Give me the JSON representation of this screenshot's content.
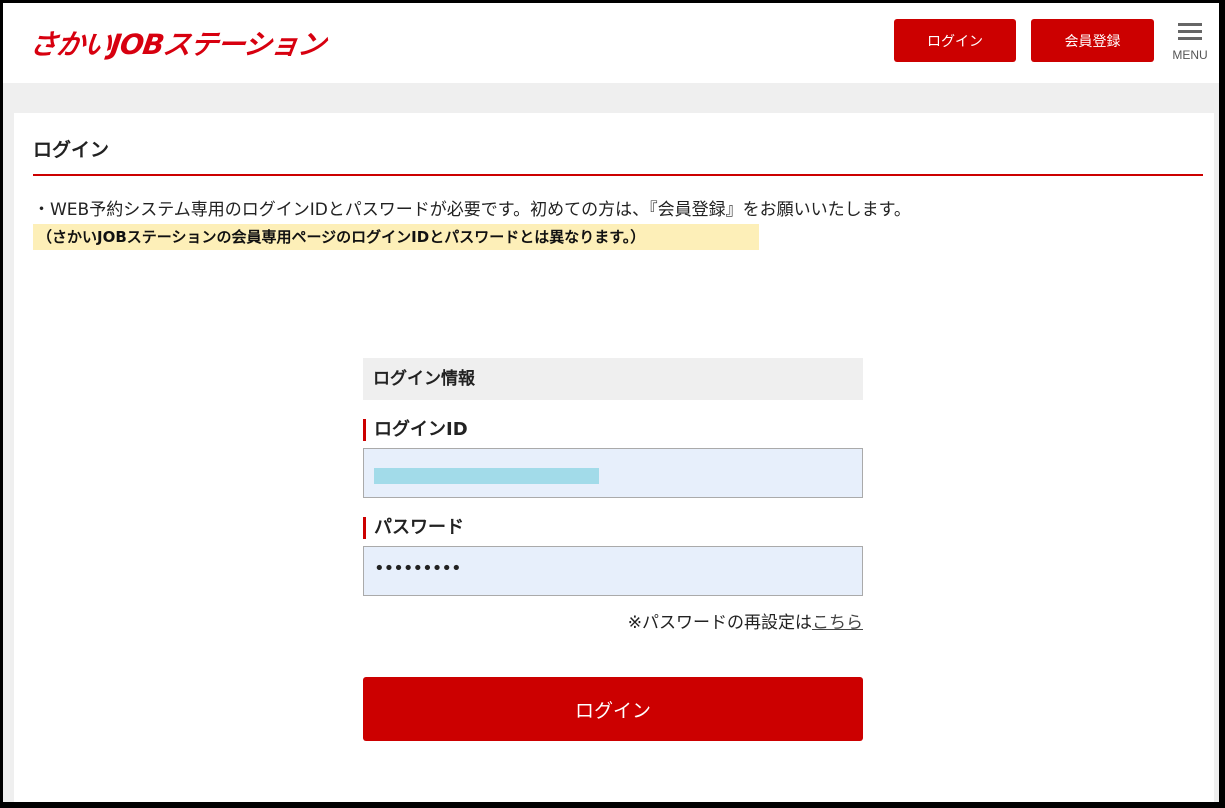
{
  "header": {
    "logo_text": "さかいJOBステーション",
    "login_button": "ログイン",
    "register_button": "会員登録",
    "menu_label": "MENU",
    "brand_color": "#cc0000"
  },
  "page": {
    "title": "ログイン",
    "notice": "・WEB予約システム専用のログインIDとパスワードが必要です。初めての方は、『会員登録』をお願いいたします。",
    "notice_highlight": "（さかいJOBステーションの会員専用ページのログインIDとパスワードとは異なります。）"
  },
  "form": {
    "section_title": "ログイン情報",
    "login_id_label": "ログインID",
    "login_id_value": "",
    "password_label": "パスワード",
    "password_value": "•••••••••",
    "reset_text": "※パスワードの再設定は",
    "reset_link": "こちら",
    "submit_label": "ログイン"
  },
  "icons": {
    "menu": "hamburger-menu-icon"
  }
}
